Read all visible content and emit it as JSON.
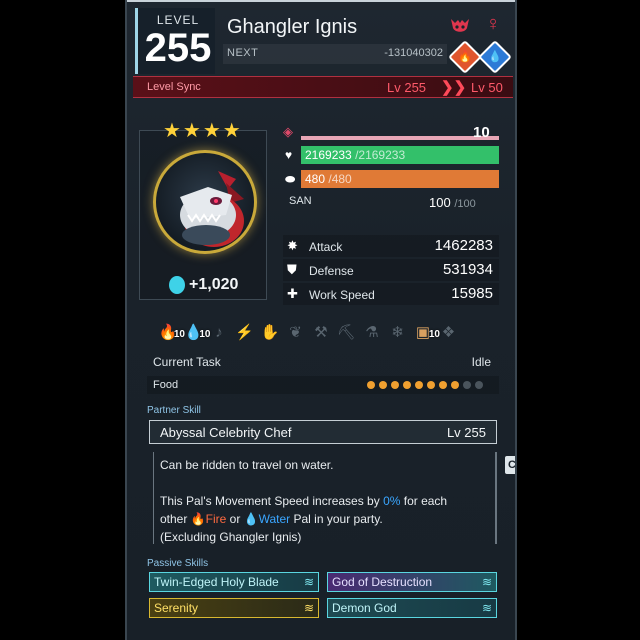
{
  "header": {
    "level_label": "LEVEL",
    "level": "255",
    "name": "Ghangler Ignis",
    "next_label": "NEXT",
    "next_value": "-131040302",
    "element_fire_icon": "fire-element-icon",
    "element_water_icon": "water-element-icon"
  },
  "sync": {
    "label": "Level Sync",
    "from": "Lv 255",
    "to": "Lv 50"
  },
  "portrait": {
    "stars": "★★★★",
    "souls": "+1,020"
  },
  "stats": {
    "trust": "10",
    "hp": "2169233",
    "hp_max": "/2169233",
    "sp": "480",
    "sp_max": "/480",
    "san_label": "SAN",
    "san": "100",
    "san_max": "/100",
    "attack_label": "Attack",
    "attack": "1462283",
    "defense_label": "Defense",
    "defense": "531934",
    "work_speed_label": "Work Speed",
    "work_speed": "15985"
  },
  "work": {
    "slots": [
      {
        "icon": "kindling-icon",
        "level": "10",
        "active": true
      },
      {
        "icon": "watering-icon",
        "level": "10",
        "active": true
      },
      {
        "icon": "music-note-icon",
        "level": "",
        "active": false
      },
      {
        "icon": "electricity-icon",
        "level": "",
        "active": false
      },
      {
        "icon": "handiwork-icon",
        "level": "",
        "active": false
      },
      {
        "icon": "gathering-icon",
        "level": "",
        "active": false
      },
      {
        "icon": "lumbering-icon",
        "level": "",
        "active": false
      },
      {
        "icon": "mining-icon",
        "level": "",
        "active": false
      },
      {
        "icon": "medicine-icon",
        "level": "",
        "active": false
      },
      {
        "icon": "cooling-icon",
        "level": "",
        "active": false
      },
      {
        "icon": "transporting-icon",
        "level": "10",
        "active": true
      },
      {
        "icon": "farming-icon",
        "level": "",
        "active": false
      }
    ],
    "current_task_label": "Current Task",
    "current_task": "Idle",
    "food_label": "Food",
    "food_filled": 8,
    "food_total": 10
  },
  "partner": {
    "section": "Partner Skill",
    "name": "Abyssal Celebrity Chef",
    "level": "Lv  255",
    "desc_1": "Can be ridden to travel on water.",
    "desc_2a": "This Pal's Movement Speed increases by ",
    "desc_2b": "0%",
    "desc_2c": " for each",
    "desc_3a": "other ",
    "desc_3b": "Fire",
    "desc_3c": " or ",
    "desc_3d": "Water",
    "desc_3e": " Pal in your party.",
    "desc_4": "(Excluding Ghangler Ignis)",
    "side_tab": "C"
  },
  "passives": {
    "section": "Passive Skills",
    "items": [
      {
        "label": "Twin-Edged Holy Blade"
      },
      {
        "label": "God of Destruction"
      },
      {
        "label": "Serenity"
      },
      {
        "label": "Demon God"
      }
    ]
  },
  "colors": {
    "hp": "#33c06a",
    "sp": "#e07a36",
    "sync": "#5a1018",
    "fire": "#ff6a40",
    "water": "#3aa6ff",
    "gold": "#ffd23a"
  }
}
